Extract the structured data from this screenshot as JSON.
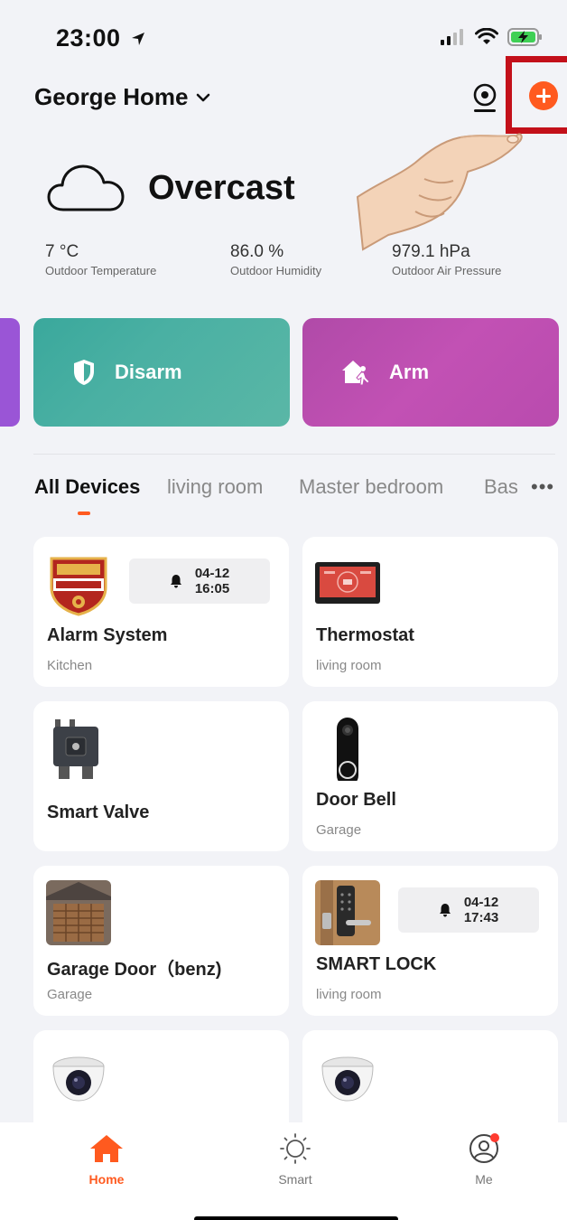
{
  "status_bar": {
    "time": "23:00"
  },
  "header": {
    "home_name": "George Home"
  },
  "weather": {
    "condition": "Overcast",
    "metrics": [
      {
        "value": "7 °C",
        "label": "Outdoor Temperature"
      },
      {
        "value": "86.0 %",
        "label": "Outdoor Humidity"
      },
      {
        "value": "979.1 hPa",
        "label": "Outdoor Air Pressure"
      }
    ]
  },
  "scenes": {
    "disarm": "Disarm",
    "arm": "Arm"
  },
  "tabs": [
    {
      "label": "All Devices"
    },
    {
      "label": "living room"
    },
    {
      "label": "Master bedroom"
    },
    {
      "label": "Bas"
    }
  ],
  "devices": [
    {
      "name": "Alarm System",
      "room": "Kitchen",
      "alert_date": "04-12",
      "alert_time": "16:05"
    },
    {
      "name": "Thermostat",
      "room": "living room"
    },
    {
      "name": "Smart Valve",
      "room": ""
    },
    {
      "name": "Door Bell",
      "room": "Garage"
    },
    {
      "name": "Garage Door（benz)",
      "room": "Garage"
    },
    {
      "name": "SMART LOCK",
      "room": "living room",
      "alert_date": "04-12",
      "alert_time": "17:43"
    }
  ],
  "tabbar": {
    "home": "Home",
    "smart": "Smart",
    "me": "Me"
  },
  "colors": {
    "accent": "#ff5a1f",
    "disarm": "#44ad9f",
    "arm": "#bf4fb2",
    "highlight": "#c3101a"
  }
}
